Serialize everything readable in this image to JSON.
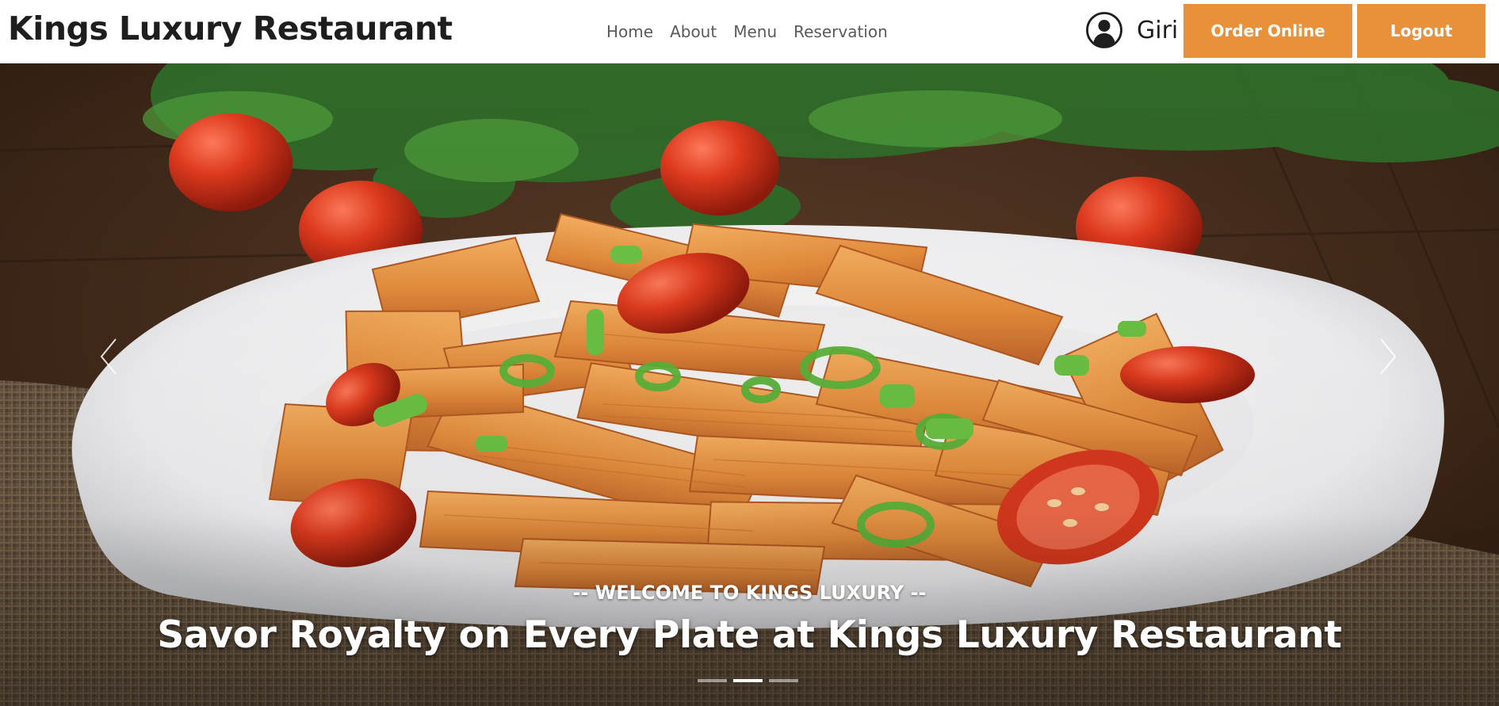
{
  "navbar": {
    "brand": "Kings Luxury Restaurant",
    "links": [
      "Home",
      "About",
      "Menu",
      "Reservation"
    ],
    "user_icon": "user-circle-icon",
    "user_name": "Giri",
    "order_label": "Order Online",
    "logout_label": "Logout",
    "accent_color": "#e8913a"
  },
  "hero": {
    "image": "pasta-penne-plate",
    "subtitle": "-- WELCOME TO KINGS LUXURY --",
    "title": "Savor Royalty on Every Plate at Kings Luxury Restaurant",
    "prev_icon": "chevron-left-icon",
    "next_icon": "chevron-right-icon",
    "slide_count": 3,
    "active_slide": 2
  }
}
